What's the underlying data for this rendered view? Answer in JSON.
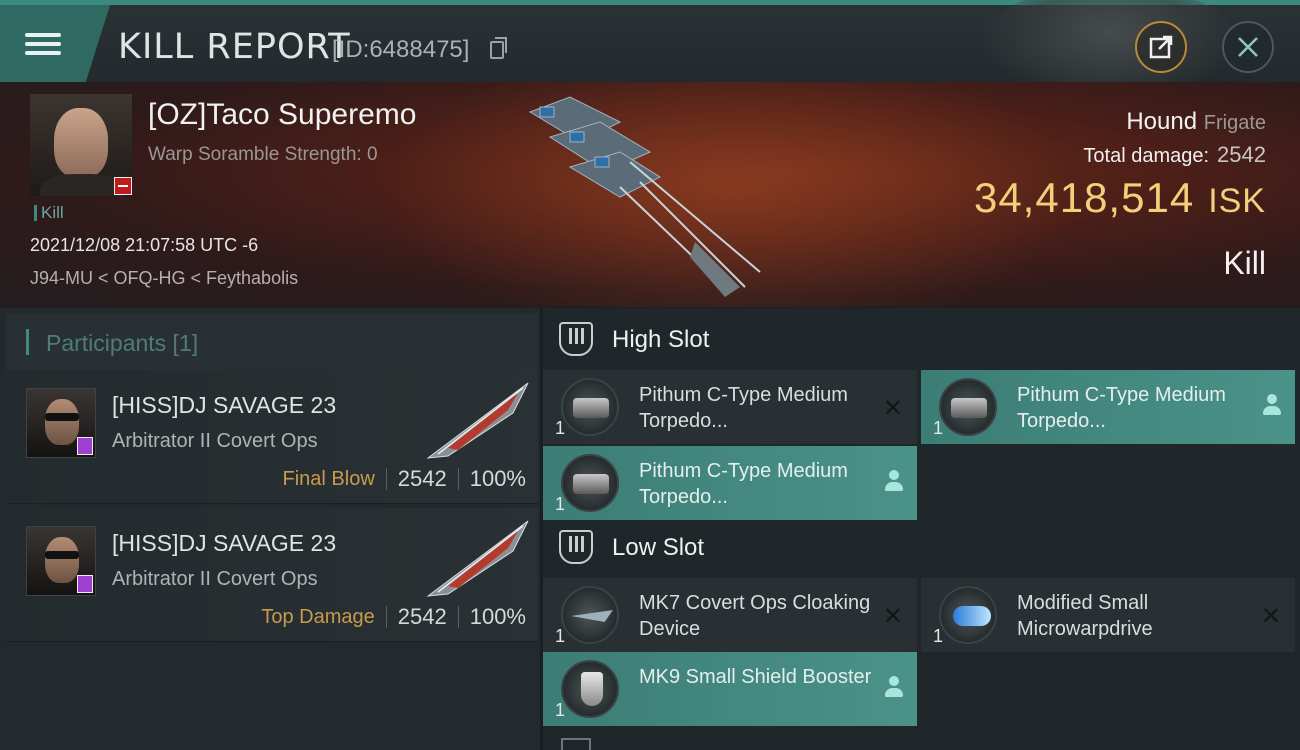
{
  "header": {
    "title": "KILL REPORT",
    "report_id": "[ID:6488475]"
  },
  "victim": {
    "name": "[OZ]Taco Superemo",
    "warp_scramble": "Warp Soramble Strength: 0",
    "kill_tag": "Kill",
    "datetime": "2021/12/08 21:07:58 UTC -6",
    "location": "J94-MU < OFQ-HG < Feythabolis",
    "ship_name": "Hound",
    "ship_class": "Frigate",
    "total_damage_label": "Total damage:",
    "total_damage_value": "2542",
    "isk_value": "34,418,514",
    "isk_unit": "ISK",
    "result": "Kill"
  },
  "participants": {
    "header": "Participants [1]",
    "rows": [
      {
        "name": "[HISS]DJ SAVAGE 23",
        "ship": "Arbitrator II Covert Ops",
        "role": "Final Blow",
        "damage": "2542",
        "percent": "100%"
      },
      {
        "name": "[HISS]DJ SAVAGE 23",
        "ship": "Arbitrator II Covert Ops",
        "role": "Top Damage",
        "damage": "2542",
        "percent": "100%"
      }
    ]
  },
  "fitting": {
    "high_slot_label": "High Slot",
    "low_slot_label": "Low Slot",
    "high_modules": [
      {
        "name": "Pithum C-Type Medium Torpedo...",
        "qty": "1",
        "status": "destroyed",
        "icon": "torpedo-launcher-icon"
      },
      {
        "name": "Pithum C-Type Medium Torpedo...",
        "qty": "1",
        "status": "dropped",
        "icon": "torpedo-launcher-icon"
      },
      {
        "name": "Pithum C-Type Medium Torpedo...",
        "qty": "1",
        "status": "dropped",
        "icon": "torpedo-launcher-icon"
      }
    ],
    "low_modules": [
      {
        "name": "MK7 Covert Ops Cloaking Device",
        "qty": "1",
        "status": "destroyed",
        "icon": "cloaking-device-icon"
      },
      {
        "name": "Modified Small Microwarpdrive",
        "qty": "1",
        "status": "destroyed",
        "icon": "microwarpdrive-icon"
      },
      {
        "name": "MK9 Small Shield Booster",
        "qty": "1",
        "status": "dropped",
        "icon": "shield-booster-icon"
      }
    ]
  },
  "colors": {
    "accent": "#3f8a80",
    "isk": "#f3cf7a",
    "role": "#c89a4e",
    "dropped_bg": "#4b9289"
  }
}
